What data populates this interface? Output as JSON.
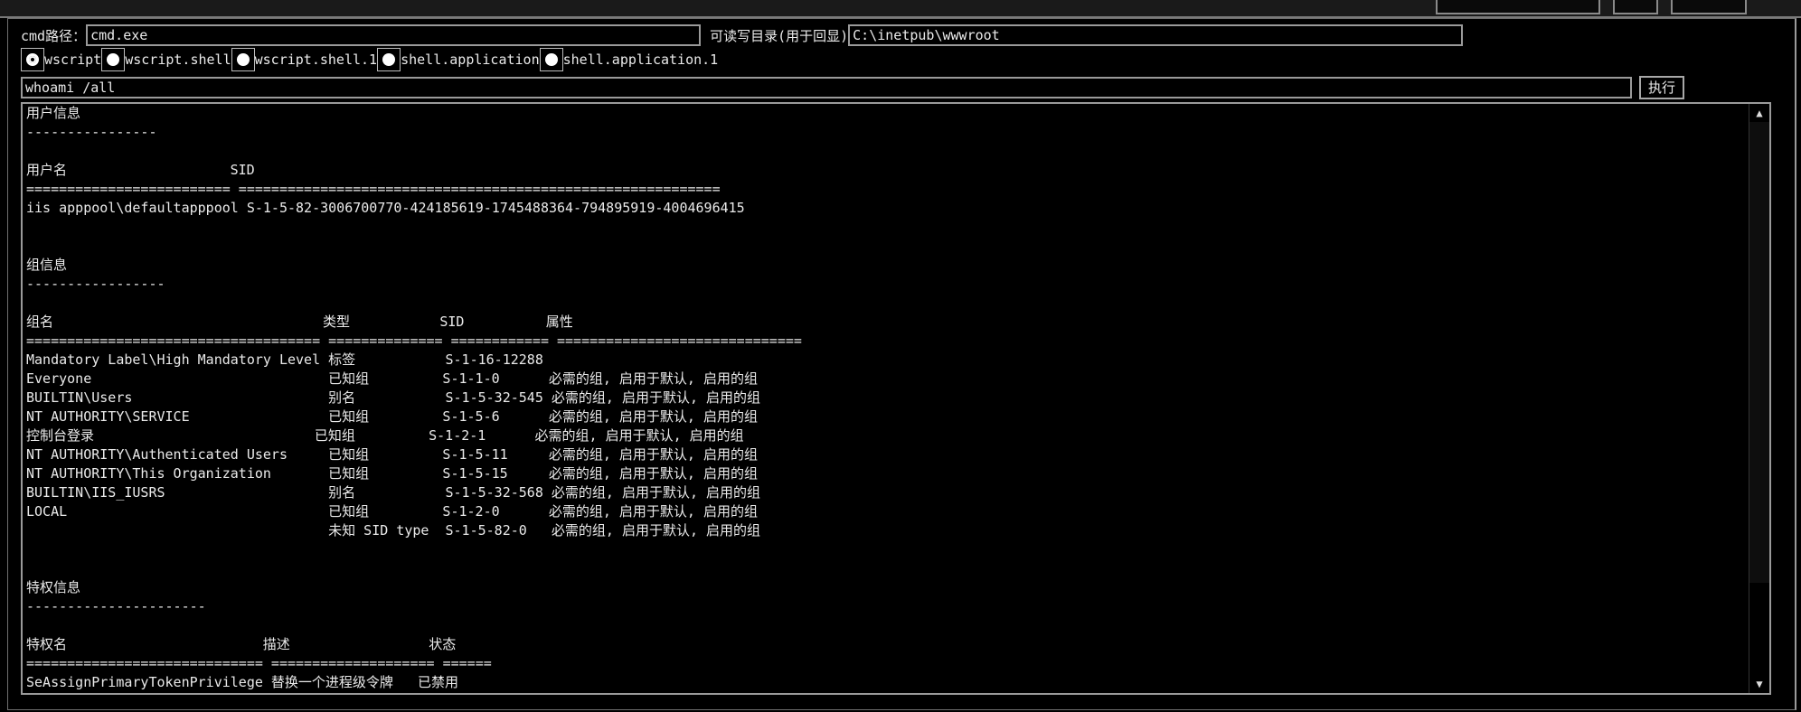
{
  "form": {
    "cmd_label": "cmd路径：",
    "cmd_value": "cmd.exe",
    "dir_label": "可读写目录(用于回显)",
    "dir_value": "C:\\inetpub\\wwwroot",
    "radios": [
      {
        "label": "wscript",
        "checked": true
      },
      {
        "label": "wscript.shell",
        "checked": false
      },
      {
        "label": "wscript.shell.1",
        "checked": false
      },
      {
        "label": "shell.application",
        "checked": false
      },
      {
        "label": "shell.application.1",
        "checked": false
      }
    ],
    "command_value": "whoami /all",
    "execute_label": "执行"
  },
  "output": {
    "text": "用户信息\n----------------\n\n用户名                    SID\n========================= ===========================================================\niis apppool\\defaultapppool S-1-5-82-3006700770-424185619-1745488364-794895919-4004696415\n\n\n组信息\n-----------------\n\n组名                                 类型           SID          属性\n==================================== ============== ============ ==============================\nMandatory Label\\High Mandatory Level 标签           S-1-16-12288\nEveryone                             已知组         S-1-1-0      必需的组, 启用于默认, 启用的组\nBUILTIN\\Users                        别名           S-1-5-32-545 必需的组, 启用于默认, 启用的组\nNT AUTHORITY\\SERVICE                 已知组         S-1-5-6      必需的组, 启用于默认, 启用的组\n控制台登录                           已知组         S-1-2-1      必需的组, 启用于默认, 启用的组\nNT AUTHORITY\\Authenticated Users     已知组         S-1-5-11     必需的组, 启用于默认, 启用的组\nNT AUTHORITY\\This Organization       已知组         S-1-5-15     必需的组, 启用于默认, 启用的组\nBUILTIN\\IIS_IUSRS                    别名           S-1-5-32-568 必需的组, 启用于默认, 启用的组\nLOCAL                                已知组         S-1-2-0      必需的组, 启用于默认, 启用的组\n                                     未知 SID type  S-1-5-82-0   必需的组, 启用于默认, 启用的组\n\n\n特权信息\n----------------------\n\n特权名                        描述                 状态\n============================= ==================== ======\nSeAssignPrimaryTokenPrivilege 替换一个进程级令牌   已禁用\nSeIncreaseQuotaPrivilege      为进程调整内存配额   已禁用"
  },
  "scrollbar": {
    "up_icon": "▲",
    "down_icon": "▼"
  }
}
